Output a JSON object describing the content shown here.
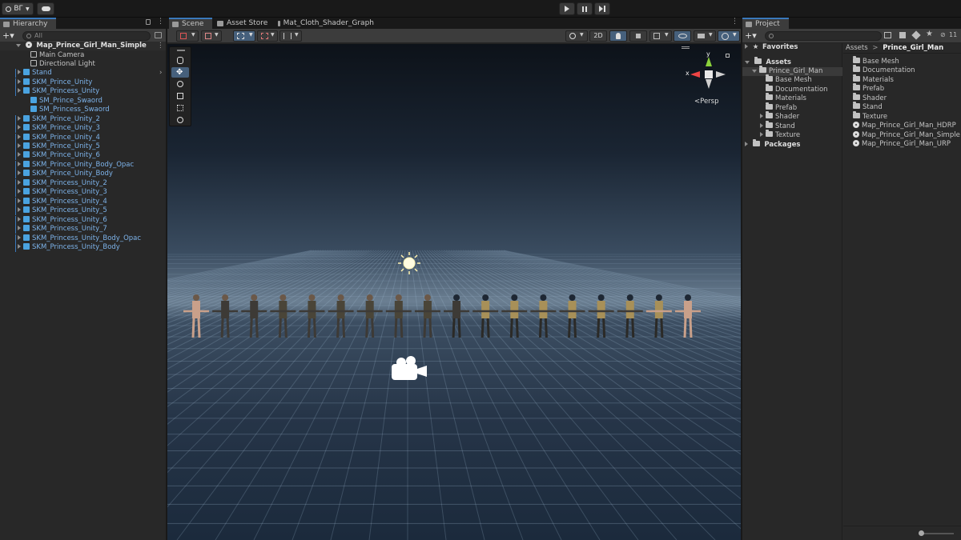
{
  "toolbar": {
    "account_label": "BГ",
    "play_icon": "play-icon",
    "pause_icon": "pause-icon",
    "step_icon": "step-icon"
  },
  "hierarchy": {
    "tab_label": "Hierarchy",
    "search_placeholder": "All",
    "scene_name": "Map_Prince_Girl_Man_Simple",
    "items": [
      {
        "label": "Main Camera",
        "type": "object",
        "indent": 2,
        "blue": false
      },
      {
        "label": "Directional Light",
        "type": "object",
        "indent": 2,
        "blue": false
      },
      {
        "label": "Stand",
        "type": "prefab",
        "indent": 1,
        "blue": true,
        "expand": true
      },
      {
        "label": "SKM_Prince_Unity",
        "type": "prefab",
        "indent": 1,
        "blue": true,
        "expand": true
      },
      {
        "label": "SKM_Princess_Unity",
        "type": "prefab",
        "indent": 1,
        "blue": true,
        "expand": true
      },
      {
        "label": "SM_Prince_Swaord",
        "type": "prefab",
        "indent": 2,
        "blue": true
      },
      {
        "label": "SM_Princess_Swaord",
        "type": "prefab",
        "indent": 2,
        "blue": true
      },
      {
        "label": "SKM_Prince_Unity_2",
        "type": "prefab",
        "indent": 1,
        "blue": true,
        "expand": true
      },
      {
        "label": "SKM_Prince_Unity_3",
        "type": "prefab",
        "indent": 1,
        "blue": true,
        "expand": true
      },
      {
        "label": "SKM_Prince_Unity_4",
        "type": "prefab",
        "indent": 1,
        "blue": true,
        "expand": true
      },
      {
        "label": "SKM_Prince_Unity_5",
        "type": "prefab",
        "indent": 1,
        "blue": true,
        "expand": true
      },
      {
        "label": "SKM_Prince_Unity_6",
        "type": "prefab",
        "indent": 1,
        "blue": true,
        "expand": true
      },
      {
        "label": "SKM_Prince_Unity_Body_Opac",
        "type": "prefab",
        "indent": 1,
        "blue": true,
        "expand": true
      },
      {
        "label": "SKM_Prince_Unity_Body",
        "type": "prefab",
        "indent": 1,
        "blue": true,
        "expand": true
      },
      {
        "label": "SKM_Princess_Unity_2",
        "type": "prefab",
        "indent": 1,
        "blue": true,
        "expand": true
      },
      {
        "label": "SKM_Princess_Unity_3",
        "type": "prefab",
        "indent": 1,
        "blue": true,
        "expand": true
      },
      {
        "label": "SKM_Princess_Unity_4",
        "type": "prefab",
        "indent": 1,
        "blue": true,
        "expand": true
      },
      {
        "label": "SKM_Princess_Unity_5",
        "type": "prefab",
        "indent": 1,
        "blue": true,
        "expand": true
      },
      {
        "label": "SKM_Princess_Unity_6",
        "type": "prefab",
        "indent": 1,
        "blue": true,
        "expand": true
      },
      {
        "label": "SKM_Princess_Unity_7",
        "type": "prefab",
        "indent": 1,
        "blue": true,
        "expand": true
      },
      {
        "label": "SKM_Princess_Unity_Body_Opac",
        "type": "prefab",
        "indent": 1,
        "blue": true,
        "expand": true
      },
      {
        "label": "SKM_Princess_Unity_Body",
        "type": "prefab",
        "indent": 1,
        "blue": true,
        "expand": true
      }
    ]
  },
  "scene": {
    "tabs": [
      {
        "label": "Scene",
        "icon": "grid-icon"
      },
      {
        "label": "Asset Store",
        "icon": "bag-icon"
      },
      {
        "label": "Mat_Cloth_Shader_Graph",
        "icon": "graph-icon"
      }
    ],
    "mode_2d_label": "2D",
    "gizmo_x": "x",
    "gizmo_y": "y",
    "persp_label": "<Persp",
    "character_count": 18
  },
  "project": {
    "tab_label": "Project",
    "favorites_label": "Favorites",
    "assets_label": "Assets",
    "packages_label": "Packages",
    "tree": [
      {
        "label": "Prince_Girl_Man",
        "level": 1,
        "expanded": true
      },
      {
        "label": "Base Mesh",
        "level": 2
      },
      {
        "label": "Documentation",
        "level": 2
      },
      {
        "label": "Materials",
        "level": 2
      },
      {
        "label": "Prefab",
        "level": 2
      },
      {
        "label": "Shader",
        "level": 2,
        "expandable": true
      },
      {
        "label": "Stand",
        "level": 2,
        "expandable": true
      },
      {
        "label": "Texture",
        "level": 2,
        "expandable": true
      }
    ],
    "breadcrumb_root": "Assets",
    "breadcrumb_sep": ">",
    "breadcrumb_leaf": "Prince_Girl_Man",
    "badge_count": "11",
    "contents": [
      {
        "label": "Base Mesh",
        "kind": "folder"
      },
      {
        "label": "Documentation",
        "kind": "folder"
      },
      {
        "label": "Materials",
        "kind": "folder"
      },
      {
        "label": "Prefab",
        "kind": "folder"
      },
      {
        "label": "Shader",
        "kind": "folder"
      },
      {
        "label": "Stand",
        "kind": "folder"
      },
      {
        "label": "Texture",
        "kind": "folder"
      },
      {
        "label": "Map_Prince_Girl_Man_HDRP",
        "kind": "scene"
      },
      {
        "label": "Map_Prince_Girl_Man_Simple",
        "kind": "scene"
      },
      {
        "label": "Map_Prince_Girl_Man_URP",
        "kind": "scene"
      }
    ]
  },
  "colors": {
    "accent": "#3a79bb",
    "prefab_blue": "#7db3ea",
    "panel_bg": "#282828",
    "chrome_bg": "#191919"
  }
}
